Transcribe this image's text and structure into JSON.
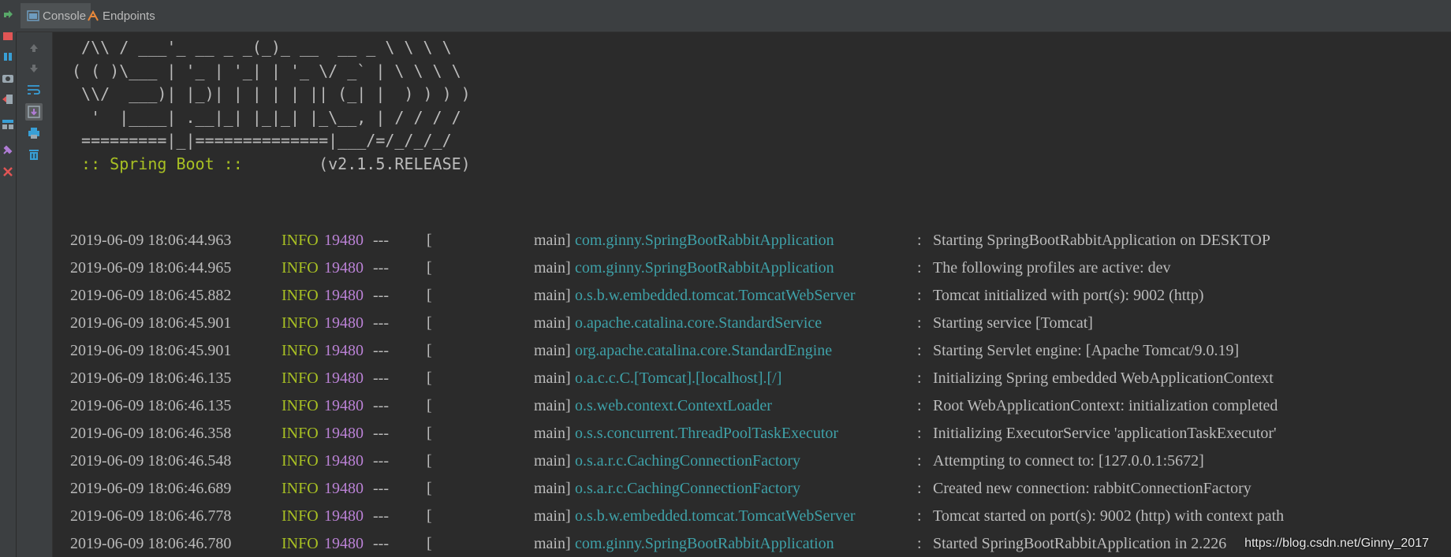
{
  "tabs": [
    {
      "label": "Console",
      "icon": "console-icon",
      "active": true
    },
    {
      "label": "Endpoints",
      "icon": "endpoints-icon",
      "active": false
    }
  ],
  "left_toolbar": [
    "rerun-icon",
    "stop-icon",
    "pause-icon",
    "dump-threads-icon",
    "exit-icon",
    "layout-icon",
    "pin-icon",
    "close-icon"
  ],
  "console_toolbar": [
    "up-arrow-icon",
    "down-arrow-icon",
    "soft-wrap-icon",
    "scroll-to-end-icon",
    "print-icon",
    "trash-icon"
  ],
  "banner": {
    "line1": " /\\\\ / ___'_ __ _ _(_)_ __  __ _ \\ \\ \\ \\",
    "line2": "( ( )\\___ | '_ | '_| | '_ \\/ _` | \\ \\ \\ \\",
    "line3": " \\\\/  ___)| |_)| | | | | || (_| |  ) ) ) )",
    "line4": "  '  |____| .__|_| |_|_| |_\\__, | / / / /",
    "line5": " =========|_|==============|___/=/_/_/_/",
    "spring_boot_label": " :: Spring Boot :: ",
    "version": "       (v2.1.5.RELEASE)"
  },
  "logs": [
    {
      "ts": "2019-06-09 18:06:44.963",
      "level": "INFO",
      "pid": "19480",
      "sep": "---",
      "thread": "main",
      "logger": "com.ginny.SpringBootRabbitApplication",
      "msg": "Starting SpringBootRabbitApplication on DESKTOP"
    },
    {
      "ts": "2019-06-09 18:06:44.965",
      "level": "INFO",
      "pid": "19480",
      "sep": "---",
      "thread": "main",
      "logger": "com.ginny.SpringBootRabbitApplication",
      "msg": "The following profiles are active: dev"
    },
    {
      "ts": "2019-06-09 18:06:45.882",
      "level": "INFO",
      "pid": "19480",
      "sep": "---",
      "thread": "main",
      "logger": "o.s.b.w.embedded.tomcat.TomcatWebServer",
      "msg": "Tomcat initialized with port(s): 9002 (http)"
    },
    {
      "ts": "2019-06-09 18:06:45.901",
      "level": "INFO",
      "pid": "19480",
      "sep": "---",
      "thread": "main",
      "logger": "o.apache.catalina.core.StandardService",
      "msg": "Starting service [Tomcat]"
    },
    {
      "ts": "2019-06-09 18:06:45.901",
      "level": "INFO",
      "pid": "19480",
      "sep": "---",
      "thread": "main",
      "logger": "org.apache.catalina.core.StandardEngine",
      "msg": "Starting Servlet engine: [Apache Tomcat/9.0.19]"
    },
    {
      "ts": "2019-06-09 18:06:46.135",
      "level": "INFO",
      "pid": "19480",
      "sep": "---",
      "thread": "main",
      "logger": "o.a.c.c.C.[Tomcat].[localhost].[/]",
      "msg": "Initializing Spring embedded WebApplicationContext"
    },
    {
      "ts": "2019-06-09 18:06:46.135",
      "level": "INFO",
      "pid": "19480",
      "sep": "---",
      "thread": "main",
      "logger": "o.s.web.context.ContextLoader",
      "msg": "Root WebApplicationContext: initialization completed"
    },
    {
      "ts": "2019-06-09 18:06:46.358",
      "level": "INFO",
      "pid": "19480",
      "sep": "---",
      "thread": "main",
      "logger": "o.s.s.concurrent.ThreadPoolTaskExecutor",
      "msg": "Initializing ExecutorService 'applicationTaskExecutor'"
    },
    {
      "ts": "2019-06-09 18:06:46.548",
      "level": "INFO",
      "pid": "19480",
      "sep": "---",
      "thread": "main",
      "logger": "o.s.a.r.c.CachingConnectionFactory",
      "msg": "Attempting to connect to: [127.0.0.1:5672]"
    },
    {
      "ts": "2019-06-09 18:06:46.689",
      "level": "INFO",
      "pid": "19480",
      "sep": "---",
      "thread": "main",
      "logger": "o.s.a.r.c.CachingConnectionFactory",
      "msg": "Created new connection: rabbitConnectionFactory"
    },
    {
      "ts": "2019-06-09 18:06:46.778",
      "level": "INFO",
      "pid": "19480",
      "sep": "---",
      "thread": "main",
      "logger": "o.s.b.w.embedded.tomcat.TomcatWebServer",
      "msg": "Tomcat started on port(s): 9002 (http) with context path"
    },
    {
      "ts": "2019-06-09 18:06:46.780",
      "level": "INFO",
      "pid": "19480",
      "sep": "---",
      "thread": "main",
      "logger": "com.ginny.SpringBootRabbitApplication",
      "msg": "Started SpringBootRabbitApplication in 2.226"
    }
  ],
  "watermark": "https://blog.csdn.net/Ginny_2017",
  "colors": {
    "info": "#a8c023",
    "pid": "#bb82d6",
    "logger": "#3ea1a8",
    "text": "#bbbbbb",
    "background": "#2b2b2b"
  }
}
